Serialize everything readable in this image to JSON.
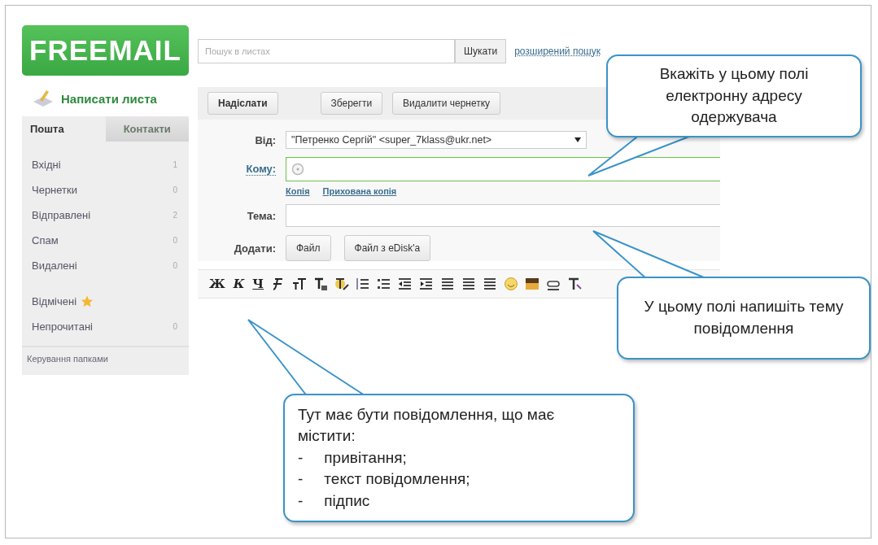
{
  "logo": "FREEMAIL",
  "search": {
    "placeholder": "Пошук в листах",
    "button": "Шукати",
    "advanced_link": "розширений пошук"
  },
  "compose_link": "Написати листа",
  "sidebar": {
    "tabs": [
      {
        "label": "Пошта",
        "selected": true
      },
      {
        "label": "Контакти",
        "selected": false
      }
    ],
    "folders": [
      {
        "name": "Вхідні",
        "count": "1",
        "starred": false
      },
      {
        "name": "Чернетки",
        "count": "0",
        "starred": false
      },
      {
        "name": "Відправлені",
        "count": "2",
        "starred": false
      },
      {
        "name": "Спам",
        "count": "0",
        "starred": false
      },
      {
        "name": "Видалені",
        "count": "0",
        "starred": false
      },
      {
        "name": "Відмічені",
        "starred": true
      },
      {
        "name": "Непрочитані",
        "count": "0",
        "starred": false
      }
    ],
    "manage_link": "Керування папками"
  },
  "toolbar": {
    "buttons": [
      "Надіслати",
      "Зберегти",
      "Видалити чернетку"
    ]
  },
  "form": {
    "from_label": "Від:",
    "from_value": "\"Петренко Сергій\" <super_7klass@ukr.net>",
    "to_label": "Кому:",
    "cc_links": [
      "Копія",
      "Прихована копія"
    ],
    "subject_label": "Тема:",
    "attach_label": "Додати:",
    "attach_buttons": [
      "Файл",
      "Файл з eDisk'a"
    ]
  },
  "editor": {
    "format_letters": [
      "Ж",
      "К",
      "Ч"
    ]
  },
  "callouts": [
    {
      "text": "Вкажіть у цьому полі електронну адресу одержувача"
    },
    {
      "text": "У цьому полі напишіть тему повідомлення"
    },
    {
      "text": "Тут має бути повідомлення, що має містити:",
      "items": [
        {
          "marker": "-",
          "text": "привітання;"
        },
        {
          "marker": "-",
          "text": "текст повідомлення;"
        },
        {
          "marker": "-",
          "text": "підпис"
        }
      ]
    }
  ]
}
